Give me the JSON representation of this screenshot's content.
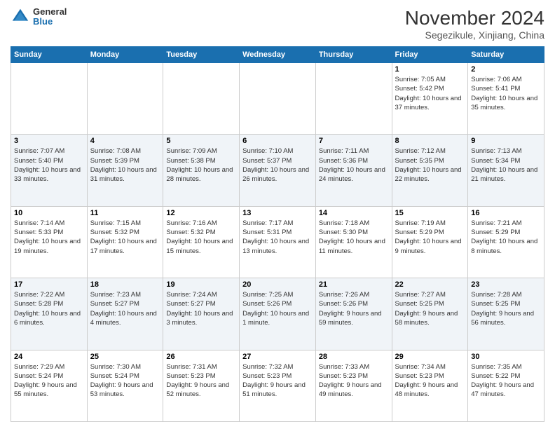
{
  "header": {
    "logo_general": "General",
    "logo_blue": "Blue",
    "month_title": "November 2024",
    "location": "Segezikule, Xinjiang, China"
  },
  "days_of_week": [
    "Sunday",
    "Monday",
    "Tuesday",
    "Wednesday",
    "Thursday",
    "Friday",
    "Saturday"
  ],
  "weeks": [
    [
      {
        "day": "",
        "info": ""
      },
      {
        "day": "",
        "info": ""
      },
      {
        "day": "",
        "info": ""
      },
      {
        "day": "",
        "info": ""
      },
      {
        "day": "",
        "info": ""
      },
      {
        "day": "1",
        "info": "Sunrise: 7:05 AM\nSunset: 5:42 PM\nDaylight: 10 hours and 37 minutes."
      },
      {
        "day": "2",
        "info": "Sunrise: 7:06 AM\nSunset: 5:41 PM\nDaylight: 10 hours and 35 minutes."
      }
    ],
    [
      {
        "day": "3",
        "info": "Sunrise: 7:07 AM\nSunset: 5:40 PM\nDaylight: 10 hours and 33 minutes."
      },
      {
        "day": "4",
        "info": "Sunrise: 7:08 AM\nSunset: 5:39 PM\nDaylight: 10 hours and 31 minutes."
      },
      {
        "day": "5",
        "info": "Sunrise: 7:09 AM\nSunset: 5:38 PM\nDaylight: 10 hours and 28 minutes."
      },
      {
        "day": "6",
        "info": "Sunrise: 7:10 AM\nSunset: 5:37 PM\nDaylight: 10 hours and 26 minutes."
      },
      {
        "day": "7",
        "info": "Sunrise: 7:11 AM\nSunset: 5:36 PM\nDaylight: 10 hours and 24 minutes."
      },
      {
        "day": "8",
        "info": "Sunrise: 7:12 AM\nSunset: 5:35 PM\nDaylight: 10 hours and 22 minutes."
      },
      {
        "day": "9",
        "info": "Sunrise: 7:13 AM\nSunset: 5:34 PM\nDaylight: 10 hours and 21 minutes."
      }
    ],
    [
      {
        "day": "10",
        "info": "Sunrise: 7:14 AM\nSunset: 5:33 PM\nDaylight: 10 hours and 19 minutes."
      },
      {
        "day": "11",
        "info": "Sunrise: 7:15 AM\nSunset: 5:32 PM\nDaylight: 10 hours and 17 minutes."
      },
      {
        "day": "12",
        "info": "Sunrise: 7:16 AM\nSunset: 5:32 PM\nDaylight: 10 hours and 15 minutes."
      },
      {
        "day": "13",
        "info": "Sunrise: 7:17 AM\nSunset: 5:31 PM\nDaylight: 10 hours and 13 minutes."
      },
      {
        "day": "14",
        "info": "Sunrise: 7:18 AM\nSunset: 5:30 PM\nDaylight: 10 hours and 11 minutes."
      },
      {
        "day": "15",
        "info": "Sunrise: 7:19 AM\nSunset: 5:29 PM\nDaylight: 10 hours and 9 minutes."
      },
      {
        "day": "16",
        "info": "Sunrise: 7:21 AM\nSunset: 5:29 PM\nDaylight: 10 hours and 8 minutes."
      }
    ],
    [
      {
        "day": "17",
        "info": "Sunrise: 7:22 AM\nSunset: 5:28 PM\nDaylight: 10 hours and 6 minutes."
      },
      {
        "day": "18",
        "info": "Sunrise: 7:23 AM\nSunset: 5:27 PM\nDaylight: 10 hours and 4 minutes."
      },
      {
        "day": "19",
        "info": "Sunrise: 7:24 AM\nSunset: 5:27 PM\nDaylight: 10 hours and 3 minutes."
      },
      {
        "day": "20",
        "info": "Sunrise: 7:25 AM\nSunset: 5:26 PM\nDaylight: 10 hours and 1 minute."
      },
      {
        "day": "21",
        "info": "Sunrise: 7:26 AM\nSunset: 5:26 PM\nDaylight: 9 hours and 59 minutes."
      },
      {
        "day": "22",
        "info": "Sunrise: 7:27 AM\nSunset: 5:25 PM\nDaylight: 9 hours and 58 minutes."
      },
      {
        "day": "23",
        "info": "Sunrise: 7:28 AM\nSunset: 5:25 PM\nDaylight: 9 hours and 56 minutes."
      }
    ],
    [
      {
        "day": "24",
        "info": "Sunrise: 7:29 AM\nSunset: 5:24 PM\nDaylight: 9 hours and 55 minutes."
      },
      {
        "day": "25",
        "info": "Sunrise: 7:30 AM\nSunset: 5:24 PM\nDaylight: 9 hours and 53 minutes."
      },
      {
        "day": "26",
        "info": "Sunrise: 7:31 AM\nSunset: 5:23 PM\nDaylight: 9 hours and 52 minutes."
      },
      {
        "day": "27",
        "info": "Sunrise: 7:32 AM\nSunset: 5:23 PM\nDaylight: 9 hours and 51 minutes."
      },
      {
        "day": "28",
        "info": "Sunrise: 7:33 AM\nSunset: 5:23 PM\nDaylight: 9 hours and 49 minutes."
      },
      {
        "day": "29",
        "info": "Sunrise: 7:34 AM\nSunset: 5:23 PM\nDaylight: 9 hours and 48 minutes."
      },
      {
        "day": "30",
        "info": "Sunrise: 7:35 AM\nSunset: 5:22 PM\nDaylight: 9 hours and 47 minutes."
      }
    ]
  ]
}
